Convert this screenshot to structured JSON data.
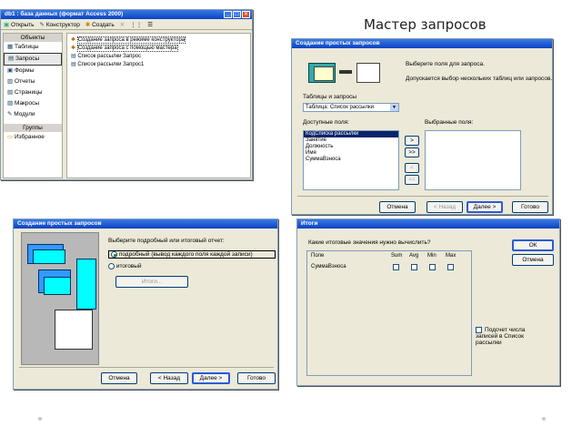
{
  "slide_title": "Мастер запросов",
  "db_window": {
    "title": "db1 : база данных (формат Access 2000)",
    "toolbar": {
      "open": "Открыть",
      "design": "Конструктор",
      "create": "Создать"
    },
    "objects_header": "Объекты",
    "sidebar": [
      "Таблицы",
      "Запросы",
      "Формы",
      "Отчеты",
      "Страницы",
      "Макросы",
      "Модули"
    ],
    "groups_header": "Группы",
    "favorites": "Избранное",
    "items": [
      "Создание запроса в режиме конструктора",
      "Создание запроса с помощью мастера",
      "Список рассылки Запрос",
      "Список рассылки Запрос1"
    ]
  },
  "wizard1": {
    "title": "Создание простых запросов",
    "prompt": "Выберите поля для запроса.",
    "hint": "Допускается выбор нескольких таблиц или запросов.",
    "tables_label": "Таблицы и запросы",
    "table_value": "Таблица: Список рассылки",
    "available_label": "Доступные поля:",
    "selected_label": "Выбранные поля:",
    "available_fields": [
      "КодСписка рассылки",
      "Занятие",
      "Должность",
      "Имя",
      "СуммаВзноса"
    ],
    "move_buttons": [
      ">",
      ">>",
      "<",
      "<<"
    ],
    "buttons": {
      "cancel": "Отмена",
      "back": "< Назад",
      "next": "Далее >",
      "finish": "Готово"
    }
  },
  "wizard2": {
    "title": "Создание простых запросов",
    "prompt": "Выберите подробный или итоговый отчет:",
    "option_detail": "подробный (вывод каждого поля каждой записи)",
    "option_summary": "итоговый",
    "totals_button": "Итоги...",
    "buttons": {
      "cancel": "Отмена",
      "back": "< Назад",
      "next": "Далее >",
      "finish": "Готово"
    }
  },
  "totals_dialog": {
    "title": "Итоги",
    "question": "Какие итоговые значения нужно вычислить?",
    "columns": [
      "Поле",
      "Sum",
      "Avg",
      "Min",
      "Max"
    ],
    "row_field": "СуммаВзноса",
    "ok": "ОК",
    "cancel": "Отмена",
    "count_label": "Подсчет числа записей в Список рассылки"
  }
}
